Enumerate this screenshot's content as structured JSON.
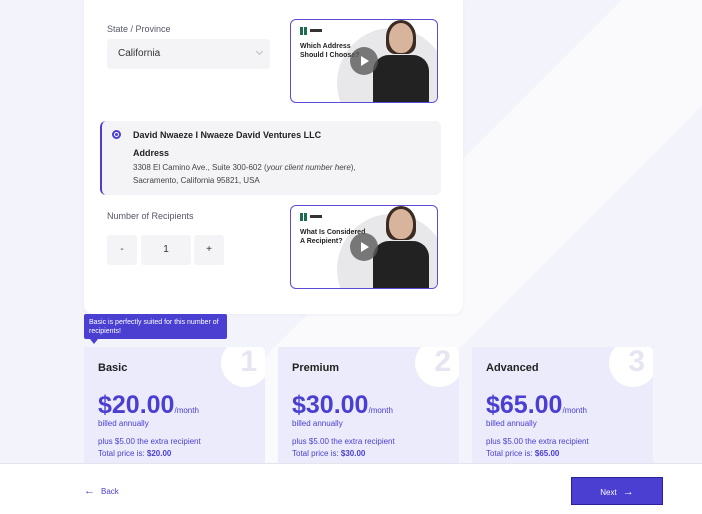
{
  "form": {
    "state_label": "State / Province",
    "state_value": "California",
    "recipients_label": "Number of Recipients",
    "recipients_value": "1",
    "minus_label": "-",
    "plus_label": "+"
  },
  "videos": [
    {
      "title": "Which Address Should I Choose?"
    },
    {
      "title": "What Is Considered A Recipient?"
    }
  ],
  "address": {
    "name": "David Nwaeze I Nwaeze David Ventures LLC",
    "heading": "Address",
    "line1_start": "3308 El Camino Ave., Suite 300-602 (",
    "line1_italic": "your client number here",
    "line1_end": "),",
    "line2": "Sacramento, California 95821, USA"
  },
  "tooltip": "Basic is perfectly suited for this number of recipients!",
  "plans": [
    {
      "number": "1",
      "name": "Basic",
      "price": "$20.00",
      "period": "/month",
      "billed": "billed annually",
      "extra": "plus $5.00 the extra recipient",
      "total_label": "Total price is: ",
      "total": "$20.00"
    },
    {
      "number": "2",
      "name": "Premium",
      "price": "$30.00",
      "period": "/month",
      "billed": "billed annually",
      "extra": "plus $5.00 the extra recipient",
      "total_label": "Total price is: ",
      "total": "$30.00"
    },
    {
      "number": "3",
      "name": "Advanced",
      "price": "$65.00",
      "period": "/month",
      "billed": "billed annually",
      "extra": "plus $5.00 the extra recipient",
      "total_label": "Total price is: ",
      "total": "$65.00"
    }
  ],
  "footer": {
    "back_label": "Back",
    "next_label": "Next",
    "back_icon": "arrow-left-icon",
    "next_icon": "arrow-right-icon"
  },
  "colors": {
    "accent": "#4a3fd0",
    "plan_bg": "#ebebfb",
    "page_bg": "#f3f3fb"
  }
}
